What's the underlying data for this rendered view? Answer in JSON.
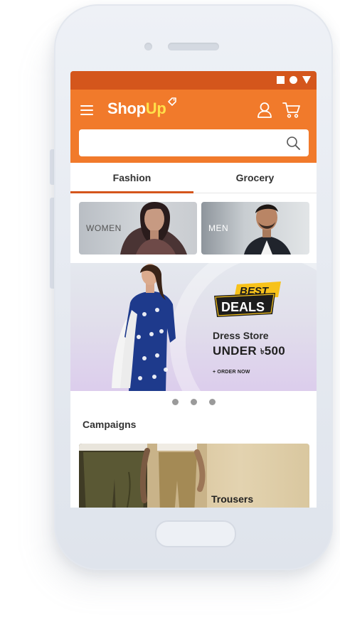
{
  "app": {
    "logo_main": "Shop",
    "logo_accent": "Up"
  },
  "colors": {
    "status_bar": "#d4561c",
    "app_bar": "#f17a2b",
    "logo_accent": "#ffe04a",
    "tab_indicator": "#d4561c",
    "badge_yellow": "#f7c21b",
    "badge_black": "#1c1c1c"
  },
  "icons": {
    "status": [
      "square-icon",
      "circle-icon",
      "triangle-icon"
    ],
    "header": [
      "menu-icon",
      "tag-icon",
      "user-icon",
      "cart-icon"
    ],
    "search": "search-icon"
  },
  "search": {
    "value": "",
    "placeholder": ""
  },
  "tabs": [
    {
      "label": "Fashion",
      "active": true
    },
    {
      "label": "Grocery",
      "active": false
    }
  ],
  "categories": [
    {
      "label": "WOMEN"
    },
    {
      "label": "MEN"
    }
  ],
  "banner": {
    "badge_top": "BEST",
    "badge_bottom": "DEALS",
    "store": "Dress Store",
    "price_prefix": "UNDER ",
    "currency": "৳",
    "price": "500",
    "cta": "+ ORDER NOW"
  },
  "carousel": {
    "dot_count": 3
  },
  "campaigns": {
    "title": "Campaigns",
    "card_title": "Trousers"
  }
}
